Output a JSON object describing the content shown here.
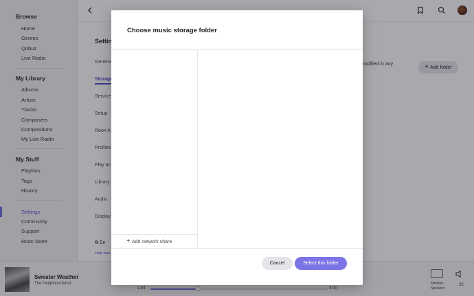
{
  "sidebar": {
    "browse_heading": "Browse",
    "browse_items": [
      "Home",
      "Genres",
      "Qobuz",
      "Live Radio"
    ],
    "library_heading": "My Library",
    "library_items": [
      "Albums",
      "Artists",
      "Tracks",
      "Composers",
      "Compositions",
      "My Live Radio"
    ],
    "stuff_heading": "My Stuff",
    "stuff_items": [
      "Playlists",
      "Tags",
      "History"
    ],
    "bottom_items": [
      "Settings",
      "Community",
      "Support",
      "Roon Store"
    ],
    "active_item": "Settings"
  },
  "settings": {
    "title": "Settin",
    "nav": [
      "Genera",
      "Storage",
      "Service",
      "Setup",
      "Roon A",
      "Profiles",
      "Play ac",
      "Library",
      "Audio",
      "Display"
    ],
    "active_nav": "Storage",
    "partial_text": "d or modified in any",
    "add_folder_label": "Add folder",
    "language_label": "En",
    "help_label": "Help tran"
  },
  "player": {
    "track_title": "Sweater Weather",
    "track_artist": "The Neighbourhood",
    "elapsed": "1:04",
    "duration": "4:00",
    "progress": 0.267,
    "zone_label": "Kitchen Speaker",
    "volume": "22"
  },
  "modal": {
    "title": "Choose music storage folder",
    "add_network_share": "Add network share",
    "cancel_label": "Cancel",
    "select_label": "Select this folder"
  },
  "colors": {
    "accent": "#7a74e6",
    "accent_text": "#4b46c8"
  },
  "icons": {
    "back": "chevron-left-icon",
    "bookmark": "bookmark-icon",
    "search": "search-icon",
    "zone": "speaker-zone-icon",
    "volume": "volume-icon"
  }
}
